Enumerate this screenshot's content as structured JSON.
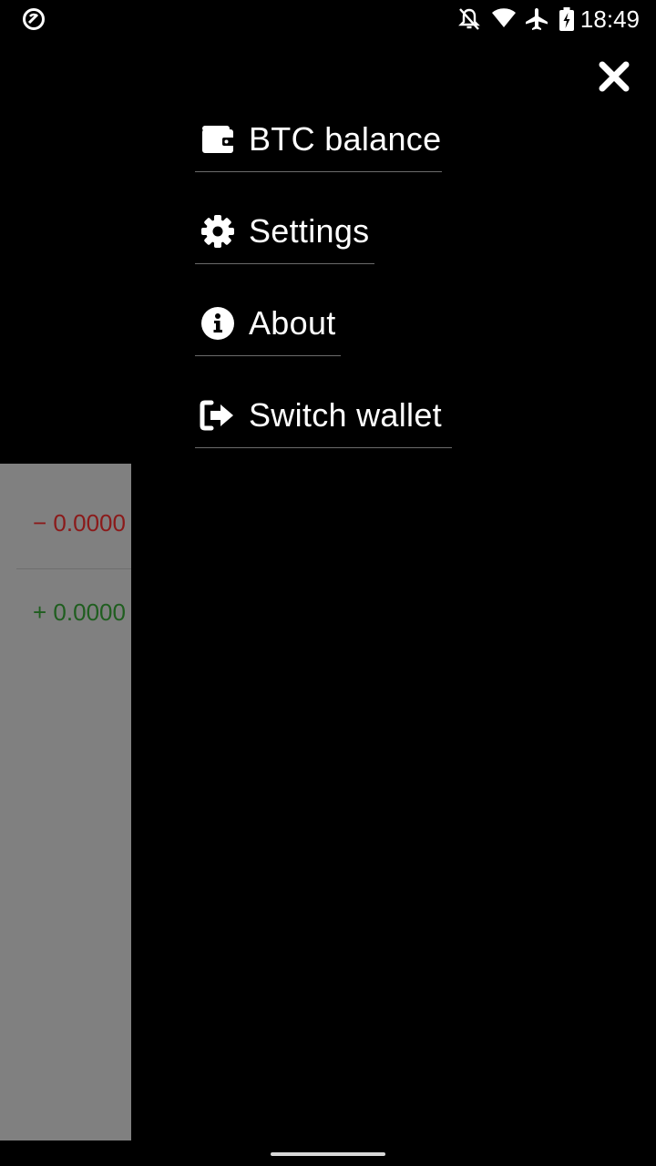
{
  "status_bar": {
    "time": "18:49",
    "icons": [
      "vpn-icon",
      "notifications-off-icon",
      "wifi-icon",
      "airplane-mode-icon",
      "battery-charging-icon"
    ]
  },
  "menu": {
    "items": [
      {
        "label": "BTC balance",
        "icon": "wallet-icon"
      },
      {
        "label": "Settings",
        "icon": "gear-icon"
      },
      {
        "label": "About",
        "icon": "info-icon"
      },
      {
        "label": "Switch wallet",
        "icon": "sign-out-icon"
      }
    ],
    "close_icon": "close-icon"
  },
  "background": {
    "transactions": [
      {
        "sign": "−",
        "amount": "0.0000",
        "color": "#8b1a1a"
      },
      {
        "sign": "+",
        "amount": "0.0000",
        "color": "#1f5e1f"
      }
    ]
  },
  "colors": {
    "overlay": "#000000",
    "text": "#ffffff",
    "divider": "#6b6b6b",
    "background_app": "#808080"
  }
}
